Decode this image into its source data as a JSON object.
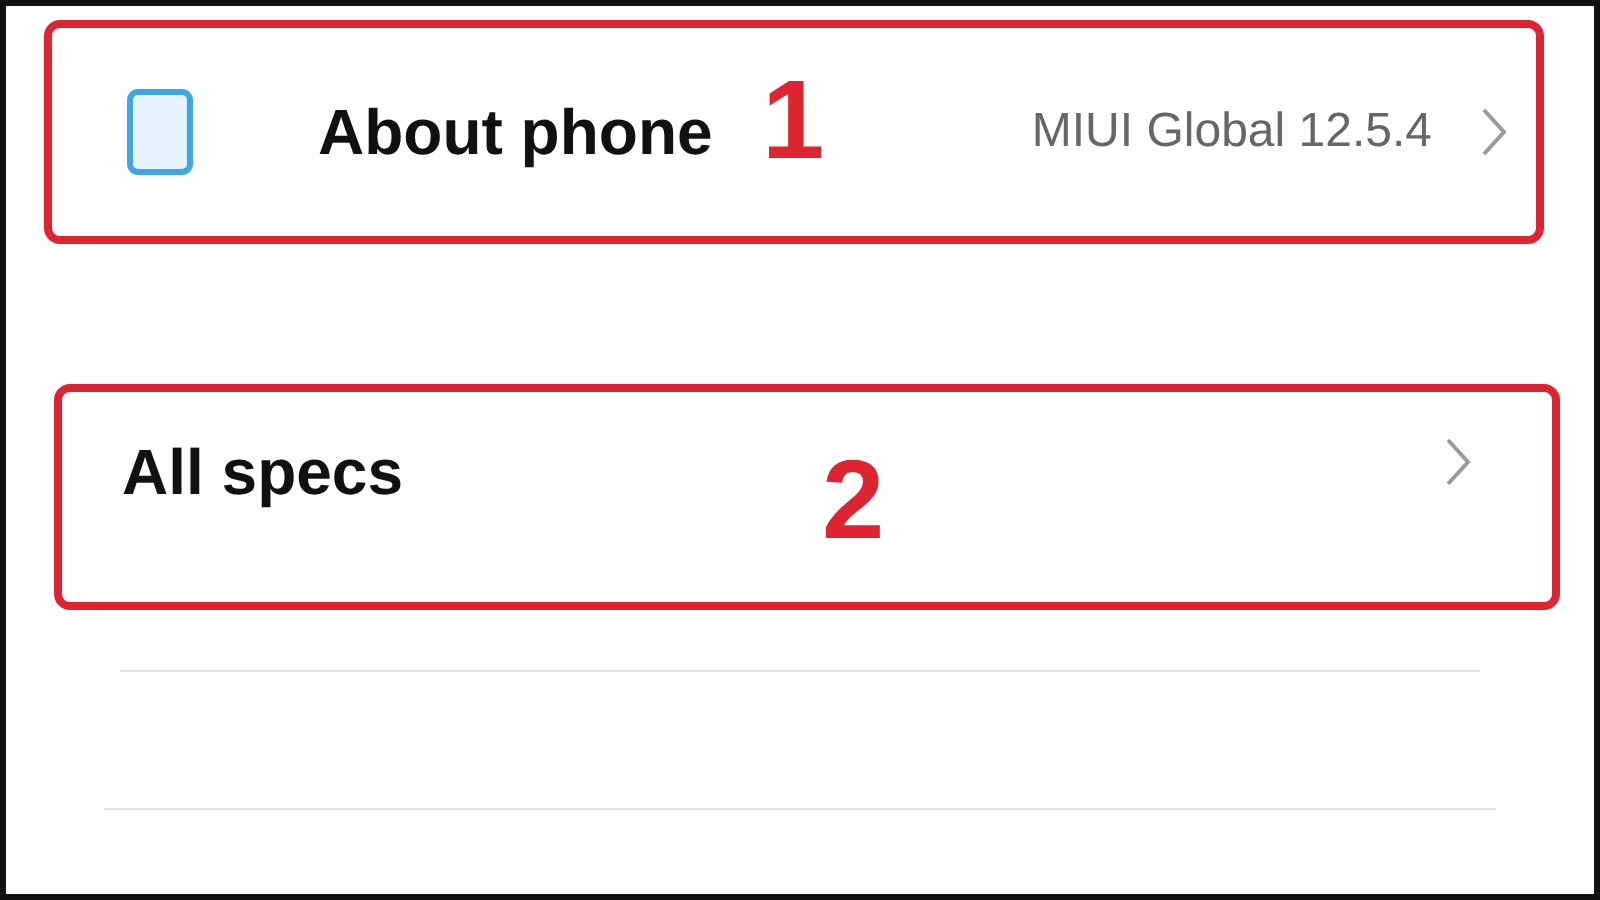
{
  "settings": [
    {
      "kind": "icon",
      "label": "About phone",
      "value": "MIUI Global 12.5.4",
      "step": "1"
    },
    {
      "kind": "plain",
      "label": "All specs",
      "step": "2"
    }
  ]
}
